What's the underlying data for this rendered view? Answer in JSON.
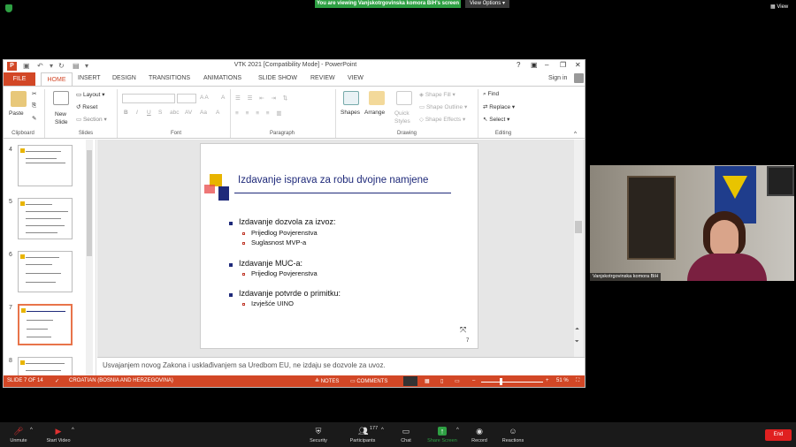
{
  "zoom": {
    "banner": "You are viewing Vanjskotrgovinska komora BiH's screen",
    "view_options": "View Options ▾",
    "view_label": "View",
    "toolbar": {
      "unmute": "Unmute",
      "start_video": "Start Video",
      "security": "Security",
      "participants": "Participants",
      "participants_count": "177",
      "chat": "Chat",
      "share_screen": "Share Screen",
      "record": "Record",
      "reactions": "Reactions",
      "end": "End"
    },
    "video": {
      "name": "Vanjskotrgovinska komora BiH"
    }
  },
  "ppt": {
    "title": "VTK 2021 [Compatibility Mode] - PowerPoint",
    "tabs": [
      "HOME",
      "INSERT",
      "DESIGN",
      "TRANSITIONS",
      "ANIMATIONS",
      "SLIDE SHOW",
      "REVIEW",
      "VIEW"
    ],
    "file_tab": "FILE",
    "sign_in": "Sign in",
    "ribbon": {
      "paste": "Paste",
      "clipboard": "Clipboard",
      "new_slide": "New Slide",
      "layout": "Layout",
      "reset": "Reset",
      "section": "Section",
      "slides": "Slides",
      "font": "Font",
      "paragraph": "Paragraph",
      "shapes": "Shapes",
      "arrange": "Arrange",
      "quick_styles": "Quick Styles",
      "shape_fill": "Shape Fill",
      "shape_outline": "Shape Outline",
      "shape_effects": "Shape Effects",
      "drawing": "Drawing",
      "find": "Find",
      "replace": "Replace",
      "select": "Select",
      "editing": "Editing"
    },
    "thumbnails": [
      "4",
      "5",
      "6",
      "7",
      "8"
    ],
    "slide": {
      "title": "Izdavanje isprava za robu dvojne namjene",
      "bullets": [
        {
          "text": "Izdavanje dozvola za izvoz:",
          "subs": [
            "Prijedlog Povjerenstva",
            "Suglasnost MVP-a"
          ]
        },
        {
          "text": "Izdavanje MUC-a:",
          "subs": [
            "Prijedlog Povjerenstva"
          ]
        },
        {
          "text": "Izdavanje potvrde o primitku:",
          "subs": [
            "Izvješće UINO"
          ]
        }
      ],
      "page_number": "7"
    },
    "notes": "Usvajanjem novog Zakona i usklađivanjem sa Uredbom EU, ne izdaju se dozvole za uvoz.",
    "status": {
      "slide_of": "SLIDE 7 OF 14",
      "language": "CROATIAN (BOSNIA AND HERZEGOVINA)",
      "notes": "NOTES",
      "comments": "COMMENTS",
      "zoom": "51 %"
    }
  }
}
